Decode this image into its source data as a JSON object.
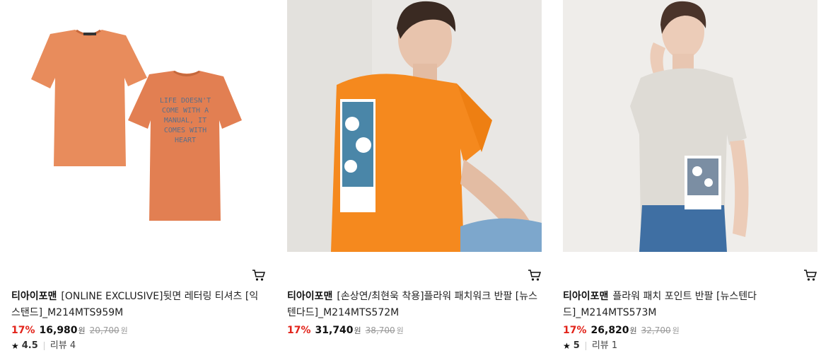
{
  "products": [
    {
      "brand": "티아이포맨",
      "name": "[ONLINE EXCLUSIVE]뒷면 레터링 티셔츠 [익스탠드]_M214MTS959M",
      "discount": "17%",
      "price": "16,980",
      "currency": "원",
      "original_price": "20,700",
      "original_currency": "원",
      "rating": "4.5",
      "review_label": "리뷰 4",
      "shirt_print": [
        "LIFE DOESN'T",
        "COME WITH A",
        "MANUAL, IT",
        "COMES WITH",
        "HEART"
      ],
      "colors": {
        "shirt": "#e88c5c",
        "bg": "#ffffff"
      }
    },
    {
      "brand": "티아이포맨",
      "name": "[손상연/최현욱 착용]플라워 패치워크 반팔 [뉴스텐다드]_M214MTS572M",
      "discount": "17%",
      "price": "31,740",
      "currency": "원",
      "original_price": "38,700",
      "original_currency": "원",
      "colors": {
        "shirt": "#f5891e",
        "bg": "#e9e7e4"
      }
    },
    {
      "brand": "티아이포맨",
      "name": "플라워 패치 포인트 반팔 [뉴스텐다드]_M214MTS573M",
      "discount": "17%",
      "price": "26,820",
      "currency": "원",
      "original_price": "32,700",
      "original_currency": "원",
      "rating": "5",
      "review_label": "리뷰 1",
      "colors": {
        "shirt": "#dedbd5",
        "bg": "#efedea"
      }
    }
  ],
  "icons": {
    "cart": "cart-icon",
    "star": "star-icon"
  }
}
